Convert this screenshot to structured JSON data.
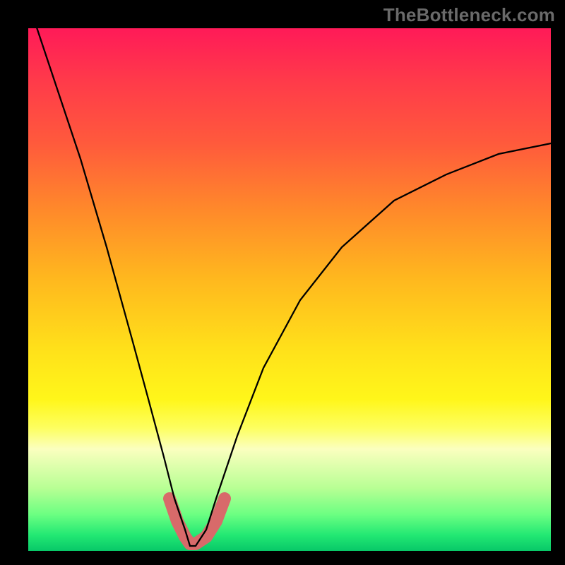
{
  "watermark": "TheBottleneck.com",
  "colors": {
    "curve": "#000000",
    "valley_highlight": "#d86a6a",
    "frame": "#000000"
  },
  "chart_data": {
    "type": "line",
    "title": "",
    "xlabel": "",
    "ylabel": "",
    "xlim": [
      0,
      100
    ],
    "ylim": [
      0,
      100
    ],
    "grid": false,
    "series": [
      {
        "name": "curve",
        "x": [
          0,
          5,
          10,
          15,
          20,
          23,
          26,
          28,
          30,
          31,
          32,
          34,
          36,
          40,
          45,
          52,
          60,
          70,
          80,
          90,
          100
        ],
        "values": [
          105,
          90,
          75,
          58,
          40,
          29,
          18,
          10,
          4,
          1,
          1,
          4,
          10,
          22,
          35,
          48,
          58,
          67,
          72,
          76,
          78
        ]
      }
    ],
    "annotations": [
      {
        "name": "valley-highlight",
        "x_range": [
          27,
          35
        ],
        "note": "thick salmon stroke tracing curve bottom"
      }
    ]
  }
}
